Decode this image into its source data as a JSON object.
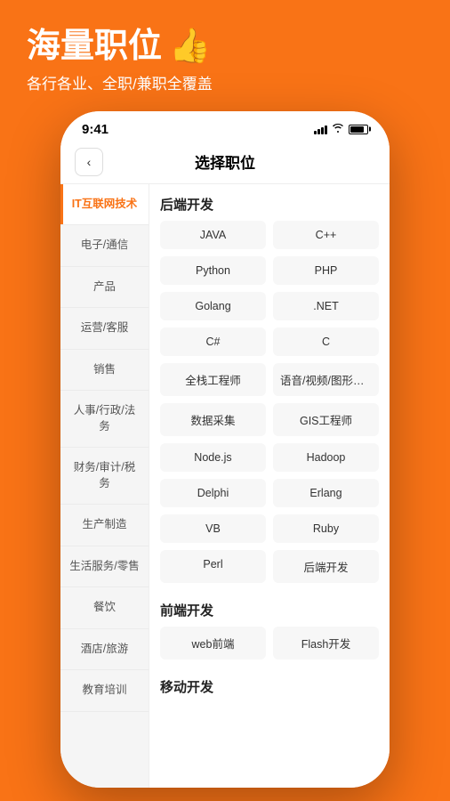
{
  "header": {
    "title": "海量职位",
    "title_icon": "👍",
    "subtitle": "各行各业、全职/兼职全覆盖"
  },
  "status_bar": {
    "time": "9:41",
    "signal": "signal",
    "wifi": "wifi",
    "battery": "battery"
  },
  "nav": {
    "back_label": "‹",
    "title": "选择职位"
  },
  "sidebar": {
    "items": [
      {
        "label": "IT互联网技术",
        "active": true
      },
      {
        "label": "电子/通信",
        "active": false
      },
      {
        "label": "产品",
        "active": false
      },
      {
        "label": "运营/客服",
        "active": false
      },
      {
        "label": "销售",
        "active": false
      },
      {
        "label": "人事/行政/法务",
        "active": false
      },
      {
        "label": "财务/审计/税务",
        "active": false
      },
      {
        "label": "生产制造",
        "active": false
      },
      {
        "label": "生活服务/零售",
        "active": false
      },
      {
        "label": "餐饮",
        "active": false
      },
      {
        "label": "酒店/旅游",
        "active": false
      },
      {
        "label": "教育培训",
        "active": false
      }
    ]
  },
  "sections": [
    {
      "title": "后端开发",
      "tags": [
        "JAVA",
        "C++",
        "Python",
        "PHP",
        "Golang",
        ".NET",
        "C#",
        "C",
        "全栈工程师",
        "语音/视频/图形开发",
        "数据采集",
        "GIS工程师",
        "Node.js",
        "Hadoop",
        "Delphi",
        "Erlang",
        "VB",
        "Ruby",
        "Perl",
        "后端开发"
      ]
    },
    {
      "title": "前端开发",
      "tags": [
        "web前端",
        "Flash开发"
      ]
    },
    {
      "title": "移动开发",
      "tags": []
    }
  ],
  "colors": {
    "accent": "#F97316",
    "active_text": "#F97316"
  }
}
